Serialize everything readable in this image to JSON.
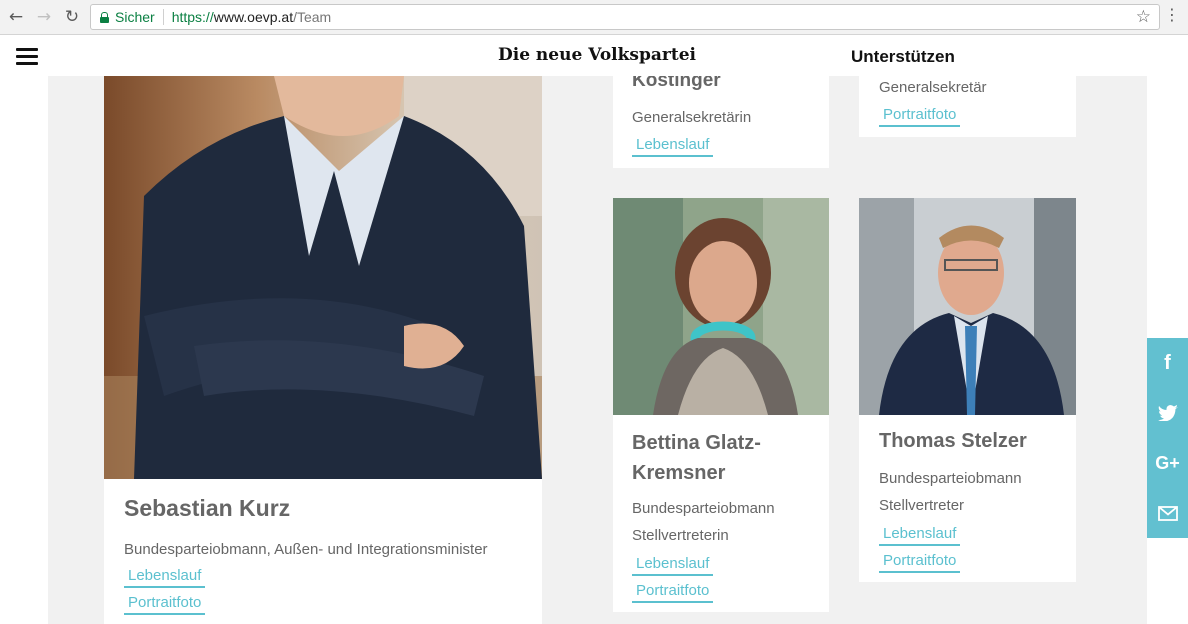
{
  "browser": {
    "secure_label": "Sicher",
    "url_scheme": "https://",
    "url_host": "www.oevp.at",
    "url_path": "/Team"
  },
  "header": {
    "brand": "Die neue Volkspartei",
    "support": "Unterstützen"
  },
  "cards": {
    "kurz": {
      "name": "Sebastian Kurz",
      "role": "Bundesparteiobmann, Außen- und Integrationsminister",
      "link1": "Lebenslauf",
      "link2": "Portraitfoto"
    },
    "koestinger": {
      "name_partial": "Köstinger",
      "role": "Generalsekretärin",
      "link1": "Lebenslauf"
    },
    "gensec": {
      "role": "Generalsekretär",
      "link1": "Portraitfoto"
    },
    "glatz": {
      "name_line1": "Bettina Glatz-",
      "name_line2": "Kremsner",
      "role_line1": "Bundesparteiobmann",
      "role_line2": "Stellvertreterin",
      "link1": "Lebenslauf",
      "link2": "Portraitfoto"
    },
    "stelzer": {
      "name": "Thomas Stelzer",
      "role_line1": "Bundesparteiobmann",
      "role_line2": "Stellvertreter",
      "link1": "Lebenslauf",
      "link2": "Portraitfoto"
    }
  },
  "share": {
    "color": "#62c0d0",
    "icons": [
      "facebook-icon",
      "twitter-icon",
      "google-plus-icon",
      "mail-icon"
    ]
  },
  "colors": {
    "accent": "#5bc0cf",
    "text": "#666666",
    "page_bg": "#f1f1f1"
  }
}
